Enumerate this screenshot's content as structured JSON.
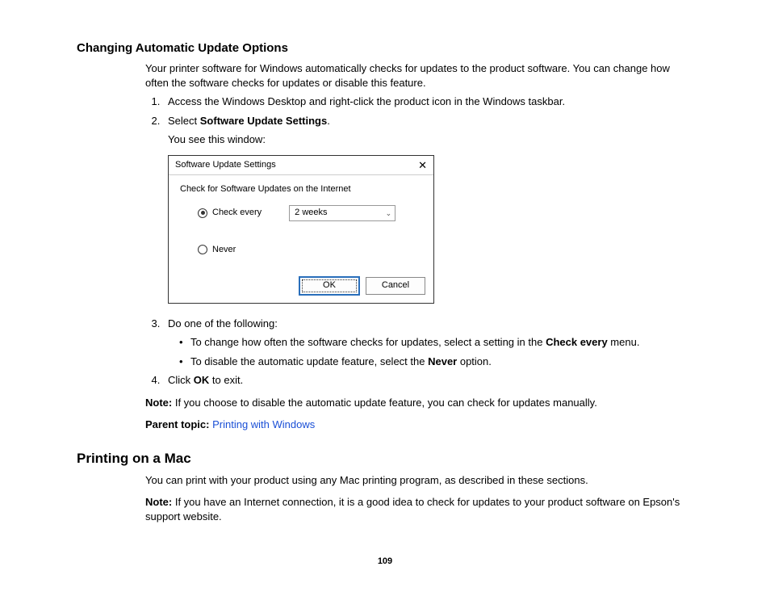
{
  "section1": {
    "heading": "Changing Automatic Update Options",
    "intro": "Your printer software for Windows automatically checks for updates to the product software. You can change how often the software checks for updates or disable this feature.",
    "step1": "Access the Windows Desktop and right-click the product icon in the Windows taskbar.",
    "step2_pre": "Select ",
    "step2_bold": "Software Update Settings",
    "step2_post": ".",
    "step2_sub": "You see this window:",
    "step3_lead": "Do one of the following:",
    "step3_b1_pre": "To change how often the software checks for updates, select a setting in the ",
    "step3_b1_bold": "Check every",
    "step3_b1_post": " menu.",
    "step3_b2_pre": "To disable the automatic update feature, select the ",
    "step3_b2_bold": "Never",
    "step3_b2_post": " option.",
    "step4_pre": "Click ",
    "step4_bold": "OK",
    "step4_post": " to exit.",
    "note_label": "Note:",
    "note_text": " If you choose to disable the automatic update feature, you can check for updates manually.",
    "parent_label": "Parent topic:",
    "parent_link": "Printing with Windows"
  },
  "dialog": {
    "title": "Software Update Settings",
    "group": "Check for Software Updates on the Internet",
    "opt_check": "Check every",
    "combo_value": "2 weeks",
    "opt_never": "Never",
    "ok": "OK",
    "cancel": "Cancel"
  },
  "section2": {
    "heading": "Printing on a Mac",
    "intro": "You can print with your product using any Mac printing program, as described in these sections.",
    "note_label": "Note:",
    "note_text": " If you have an Internet connection, it is a good idea to check for updates to your product software on Epson's support website."
  },
  "page_number": "109"
}
